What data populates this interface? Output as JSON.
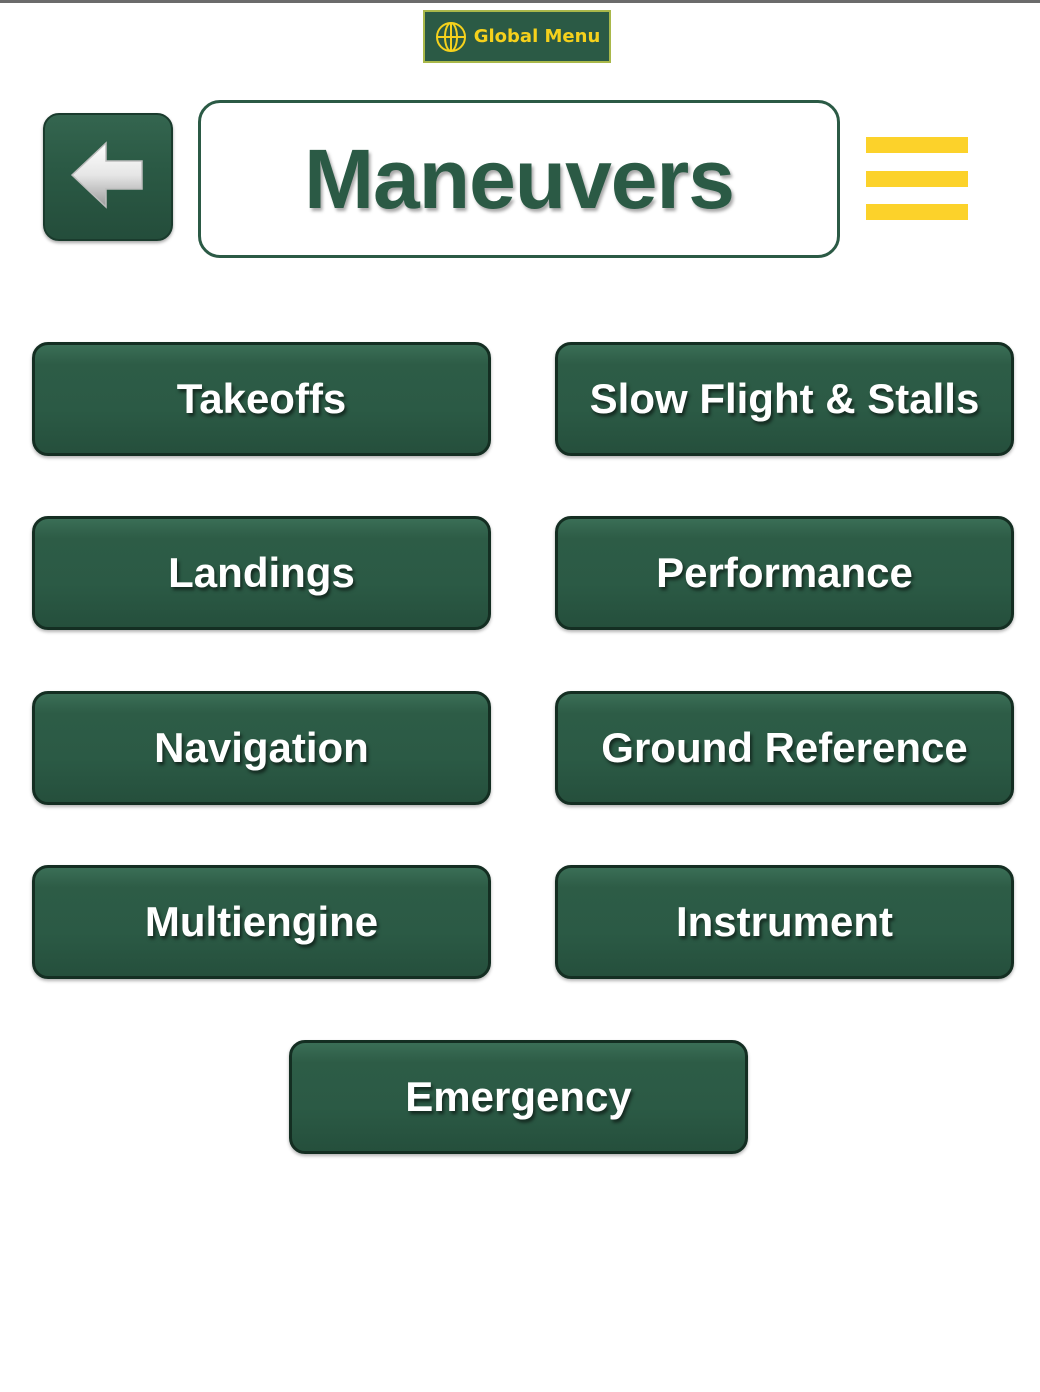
{
  "global_menu": {
    "label": "Global Menu",
    "icon": "globe-icon"
  },
  "header": {
    "title": "Maneuvers",
    "back_icon": "back-arrow-icon",
    "menu_icon": "hamburger-menu-icon"
  },
  "buttons": [
    {
      "label": "Takeoffs"
    },
    {
      "label": "Slow Flight & Stalls"
    },
    {
      "label": "Landings"
    },
    {
      "label": "Performance"
    },
    {
      "label": "Navigation"
    },
    {
      "label": "Ground Reference"
    },
    {
      "label": "Multiengine"
    },
    {
      "label": "Instrument"
    },
    {
      "label": "Emergency"
    }
  ],
  "colors": {
    "primary_green": "#2b5a45",
    "accent_yellow": "#fcd22a",
    "text_white": "#ffffff"
  }
}
